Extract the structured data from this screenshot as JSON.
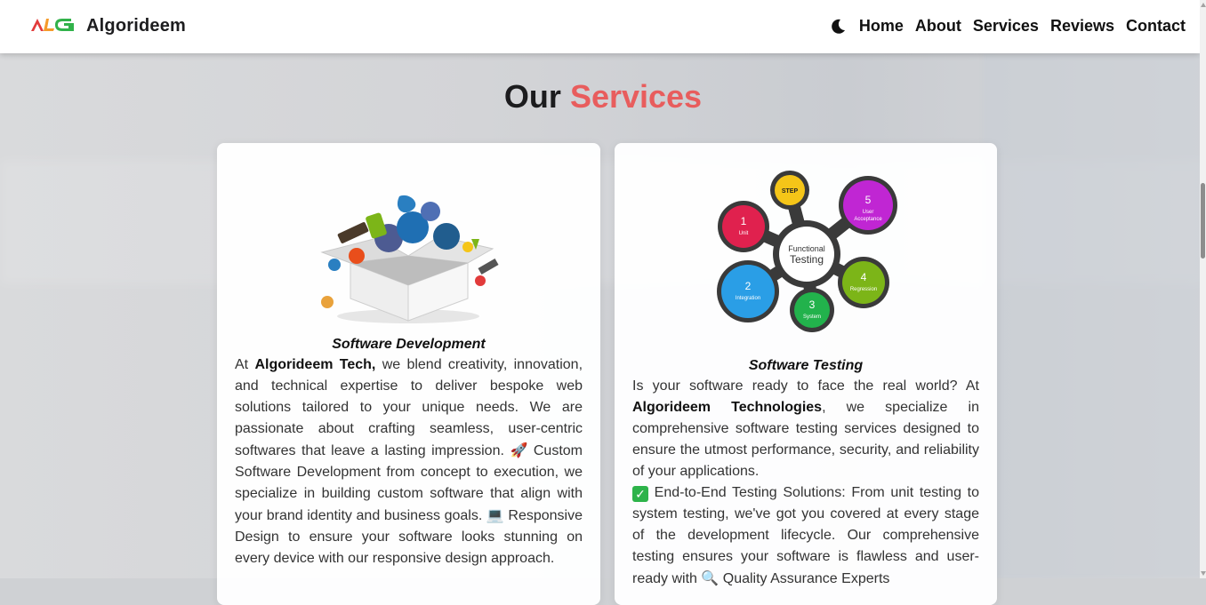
{
  "header": {
    "logo_text": "ALG",
    "brand": "Algorideem",
    "theme_toggle_icon": "moon-icon",
    "nav": [
      {
        "label": "Home"
      },
      {
        "label": "About"
      },
      {
        "label": "Services"
      },
      {
        "label": "Reviews"
      },
      {
        "label": "Contact"
      }
    ]
  },
  "section": {
    "title_part1": "Our",
    "title_part2": "Services",
    "accent_color": "#e85d5d"
  },
  "cards": [
    {
      "title": "Software Development",
      "image_icon": "open-box-tech-logos-illustration",
      "p1_prefix": "At ",
      "p1_bold": "Algorideem Tech,",
      "p1_rest": " we blend creativity, innovation, and technical expertise to deliver bespoke web solutions tailored to your unique needs. We are passionate about crafting seamless, user-centric softwares that leave a lasting impression.",
      "emoji1": "🚀",
      "p2": " Custom Software Development from concept to execution, we specialize in building custom software that align with your brand identity and business goals.",
      "emoji2": "💻",
      "p3": " Responsive Design to ensure your software looks stunning on every device with our responsive design approach."
    },
    {
      "title": "Software Testing",
      "image_icon": "functional-testing-diagram",
      "diagram": {
        "center_line1": "Functional",
        "center_line2": "Testing",
        "nodes": [
          {
            "num": "",
            "label": "STEP",
            "color": "#f5c518"
          },
          {
            "num": "5",
            "label": "User Acceptance",
            "color": "#c026d3"
          },
          {
            "num": "4",
            "label": "Regression",
            "color": "#7cb518"
          },
          {
            "num": "3",
            "label": "System",
            "color": "#22b24c"
          },
          {
            "num": "2",
            "label": "Integration",
            "color": "#2a9ee6"
          },
          {
            "num": "1",
            "label": "Unit",
            "color": "#e0214e"
          }
        ]
      },
      "p1_prefix": "Is your software ready to face the real world? At ",
      "p1_bold": "Algorideem Technologies",
      "p1_rest": ", we specialize in comprehensive software testing services designed to ensure the utmost performance, security, and reliability of your applications.",
      "check": "✓",
      "p2": " End-to-End Testing Solutions: From unit testing to system testing, we've got you covered at every stage of the development lifecycle. Our comprehensive testing ensures your software is flawless and user-ready with",
      "emoji2": "🔍",
      "p3": " Quality Assurance Experts"
    }
  ]
}
